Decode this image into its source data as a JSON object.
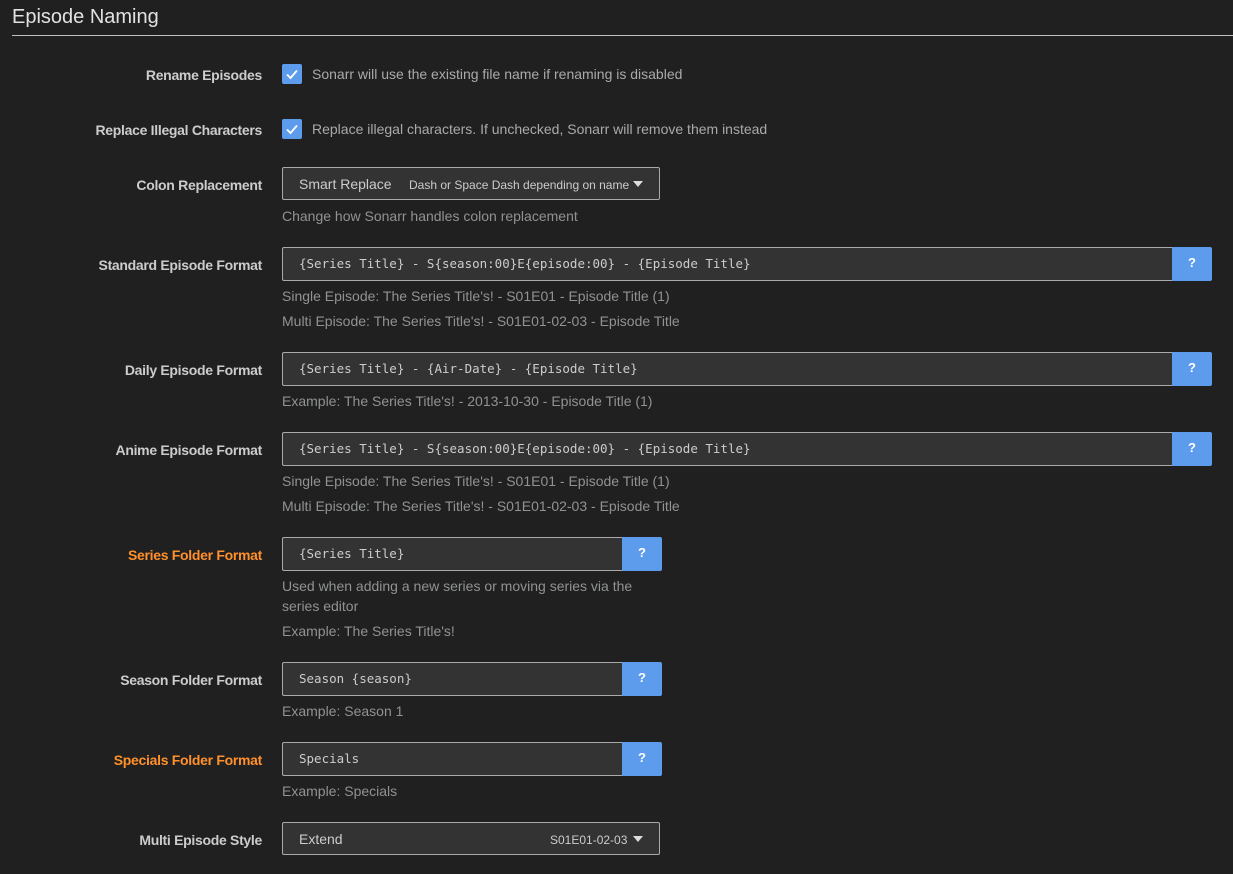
{
  "section": {
    "title": "Episode Naming"
  },
  "rename_episodes": {
    "label": "Rename Episodes",
    "checked": true,
    "help": "Sonarr will use the existing file name if renaming is disabled"
  },
  "replace_illegal": {
    "label": "Replace Illegal Characters",
    "checked": true,
    "help": "Replace illegal characters. If unchecked, Sonarr will remove them instead"
  },
  "colon_replacement": {
    "label": "Colon Replacement",
    "value": "Smart Replace",
    "value_hint": "Dash or Space Dash depending on name",
    "help": "Change how Sonarr handles colon replacement"
  },
  "standard_format": {
    "label": "Standard Episode Format",
    "value": "{Series Title} - S{season:00}E{episode:00} - {Episode Title}",
    "help_button": "?",
    "examples": [
      "Single Episode: The Series Title's! - S01E01 - Episode Title (1)",
      "Multi Episode: The Series Title's! - S01E01-02-03 - Episode Title"
    ]
  },
  "daily_format": {
    "label": "Daily Episode Format",
    "value": "{Series Title} - {Air-Date} - {Episode Title}",
    "help_button": "?",
    "examples": [
      "Example: The Series Title's! - 2013-10-30 - Episode Title (1)"
    ]
  },
  "anime_format": {
    "label": "Anime Episode Format",
    "value": "{Series Title} - S{season:00}E{episode:00} - {Episode Title}",
    "help_button": "?",
    "examples": [
      "Single Episode: The Series Title's! - S01E01 - Episode Title (1)",
      "Multi Episode: The Series Title's! - S01E01-02-03 - Episode Title"
    ]
  },
  "series_folder": {
    "label": "Series Folder Format",
    "advanced": true,
    "value": "{Series Title}",
    "help_button": "?",
    "help_line1": "Used when adding a new series or moving series via the",
    "help_line2": "series editor",
    "example": "Example: The Series Title's!"
  },
  "season_folder": {
    "label": "Season Folder Format",
    "value": "Season {season}",
    "help_button": "?",
    "example": "Example: Season 1"
  },
  "specials_folder": {
    "label": "Specials Folder Format",
    "advanced": true,
    "value": "Specials",
    "help_button": "?",
    "example": "Example: Specials"
  },
  "multi_episode_style": {
    "label": "Multi Episode Style",
    "value": "Extend",
    "value_hint": "S01E01-02-03"
  },
  "colors": {
    "background": "#202020",
    "accent": "#5d9cec",
    "advanced_label": "#ff902b"
  }
}
